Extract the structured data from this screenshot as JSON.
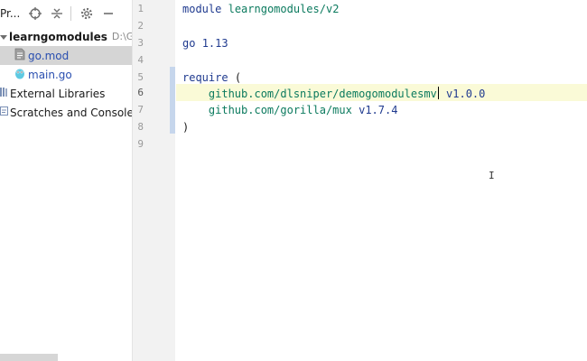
{
  "project_panel": {
    "title": "Pr...",
    "tree": {
      "root": {
        "label": "learngomodules",
        "path": "D:\\GoLa"
      },
      "files": [
        {
          "label": "go.mod",
          "selected": true,
          "icon": "file-icon"
        },
        {
          "label": "main.go",
          "selected": false,
          "icon": "gopher-icon"
        }
      ],
      "external_libraries": "External Libraries",
      "scratches": "Scratches and Consoles"
    },
    "toolbar_icons": [
      "target-icon",
      "collapse-icon",
      "gear-icon",
      "minimize-icon"
    ]
  },
  "editor": {
    "line_numbers": [
      "1",
      "2",
      "3",
      "4",
      "5",
      "6",
      "7",
      "8",
      "9"
    ],
    "current_line": "6",
    "lines": {
      "l1_kw": "module",
      "l1_path": "learngomodules/v2",
      "l3_kw": "go",
      "l3_ver": "1.13",
      "l5_kw": "require",
      "l5_paren": "(",
      "l6_pkg_a": "github.com/dlsniper/demogomodulesmv",
      "l6_ver": "v1.0.0",
      "l7_pkg": "github.com/gorilla/mux",
      "l7_ver": "v1.7.4",
      "l8_paren": ")"
    },
    "ibeam": "I"
  },
  "colors": {
    "keyword": "#1f3a8f",
    "package_path": "#0b7a5e",
    "selected_row": "#d5d5d5",
    "gutter": "#f2f2f2",
    "caret_line": "#fafad7"
  }
}
